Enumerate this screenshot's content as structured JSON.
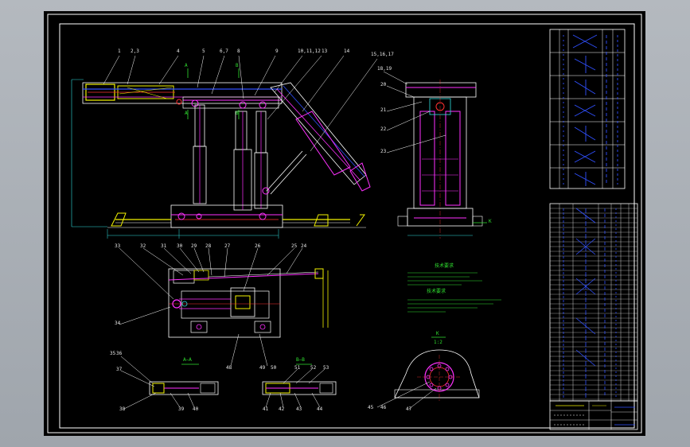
{
  "drawing": {
    "background": "#000000",
    "colors": {
      "frame": "#ffffff",
      "yellow": "#f2f200",
      "magenta": "#ff30ff",
      "red": "#ff3030",
      "cyan": "#30e0e0",
      "green": "#30e030",
      "blue": "#3050ff"
    }
  },
  "callouts": {
    "top": [
      "1",
      "2,3",
      "4",
      "5",
      "6,7",
      "8",
      "9",
      "10,11,12",
      "13",
      "14",
      "15,16,17"
    ],
    "side_view": [
      "18,19",
      "20",
      "21",
      "22",
      "23"
    ],
    "plan_view": [
      "33",
      "32",
      "31",
      "30",
      "29",
      "28",
      "27",
      "26",
      "25",
      "24",
      "34"
    ],
    "plan_bottom": [
      "48",
      "49",
      "50"
    ],
    "section_aa": [
      "35",
      "36",
      "37",
      "38",
      "39",
      "40"
    ],
    "section_bb": [
      "51",
      "52",
      "53",
      "41",
      "42",
      "43",
      "44"
    ],
    "detail_k": [
      "45",
      "46",
      "47"
    ]
  },
  "section_titles": {
    "aa": "A—A",
    "bb": "B—B",
    "k": "K",
    "k_scale": "1:2"
  },
  "marks": {
    "a_top": "A",
    "a_bottom": "A",
    "b_top": "B",
    "b_bottom": "B",
    "k_arrow": "K"
  },
  "notes": {
    "title1": "技术要求",
    "title2": "技术要求"
  }
}
